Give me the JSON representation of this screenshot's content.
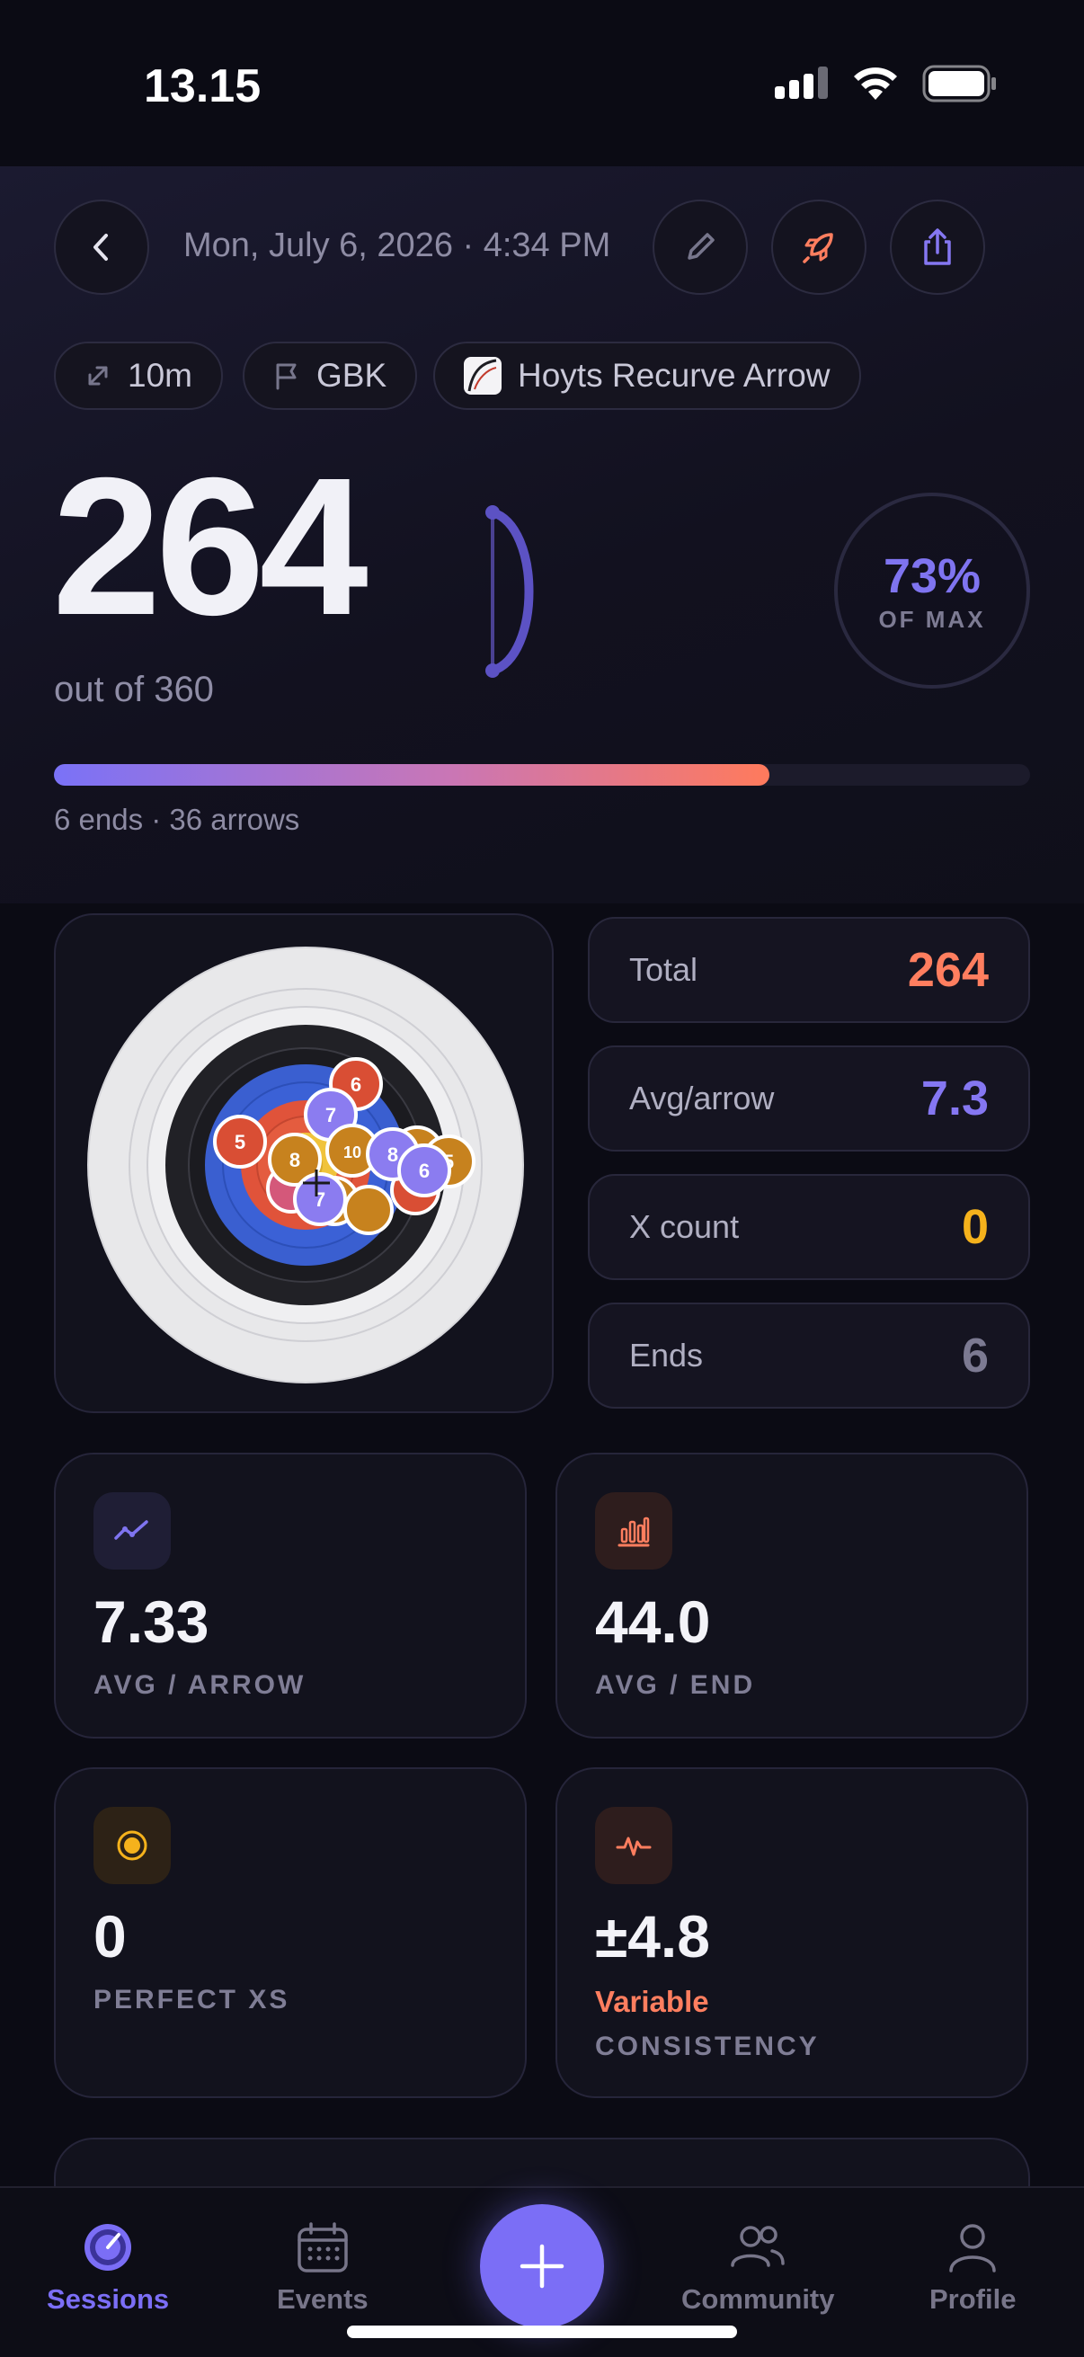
{
  "status_bar": {
    "time": "13.15"
  },
  "header": {
    "date": "Mon, July 6, 2026 · 4:34 PM",
    "chips": {
      "distance": "10m",
      "round": "GBK",
      "equipment": "Hoyts Recurve Arrow"
    }
  },
  "score": {
    "value": "264",
    "out_of": "out of 360",
    "percent": "73%",
    "percent_label": "OF MAX",
    "progress_fraction": 0.733,
    "summary": "6 ends · 36 arrows"
  },
  "target": {
    "arrows": [
      {
        "label": "6",
        "color": "#d94e34"
      },
      {
        "label": "7",
        "color": "#8b7cf0"
      },
      {
        "label": "5",
        "color": "#d94e34"
      },
      {
        "label": "8",
        "color": "#c7821e"
      },
      {
        "label": "10",
        "color": "#c7821e"
      },
      {
        "label": "7",
        "color": "#c7821e"
      },
      {
        "label": "8",
        "color": "#8b7cf0"
      },
      {
        "label": "5",
        "color": "#c7821e"
      },
      {
        "label": "6",
        "color": "#8b7cf0"
      },
      {
        "label": "7",
        "color": "#8b7cf0"
      }
    ]
  },
  "stats": [
    {
      "label": "Total",
      "value": "264",
      "color": "#ff7e5f"
    },
    {
      "label": "Avg/arrow",
      "value": "7.3",
      "color": "#8577f2"
    },
    {
      "label": "X count",
      "value": "0",
      "color": "#f5b21c"
    },
    {
      "label": "Ends",
      "value": "6",
      "color": "#7c7a92"
    }
  ],
  "metrics": [
    {
      "value": "7.33",
      "label": "AVG / ARROW",
      "icon": "trend-line-icon"
    },
    {
      "value": "44.0",
      "label": "AVG / END",
      "icon": "bar-chart-icon"
    },
    {
      "value": "0",
      "label": "PERFECT XS",
      "icon": "bullseye-icon"
    },
    {
      "value": "±4.8",
      "label": "CONSISTENCY",
      "badge": "Variable",
      "icon": "pulse-icon"
    }
  ],
  "nav": {
    "sessions": "Sessions",
    "events": "Events",
    "community": "Community",
    "profile": "Profile"
  },
  "colors": {
    "accent": "#7b6ef6",
    "orange": "#ff7e5f",
    "gold": "#f5b21c"
  }
}
